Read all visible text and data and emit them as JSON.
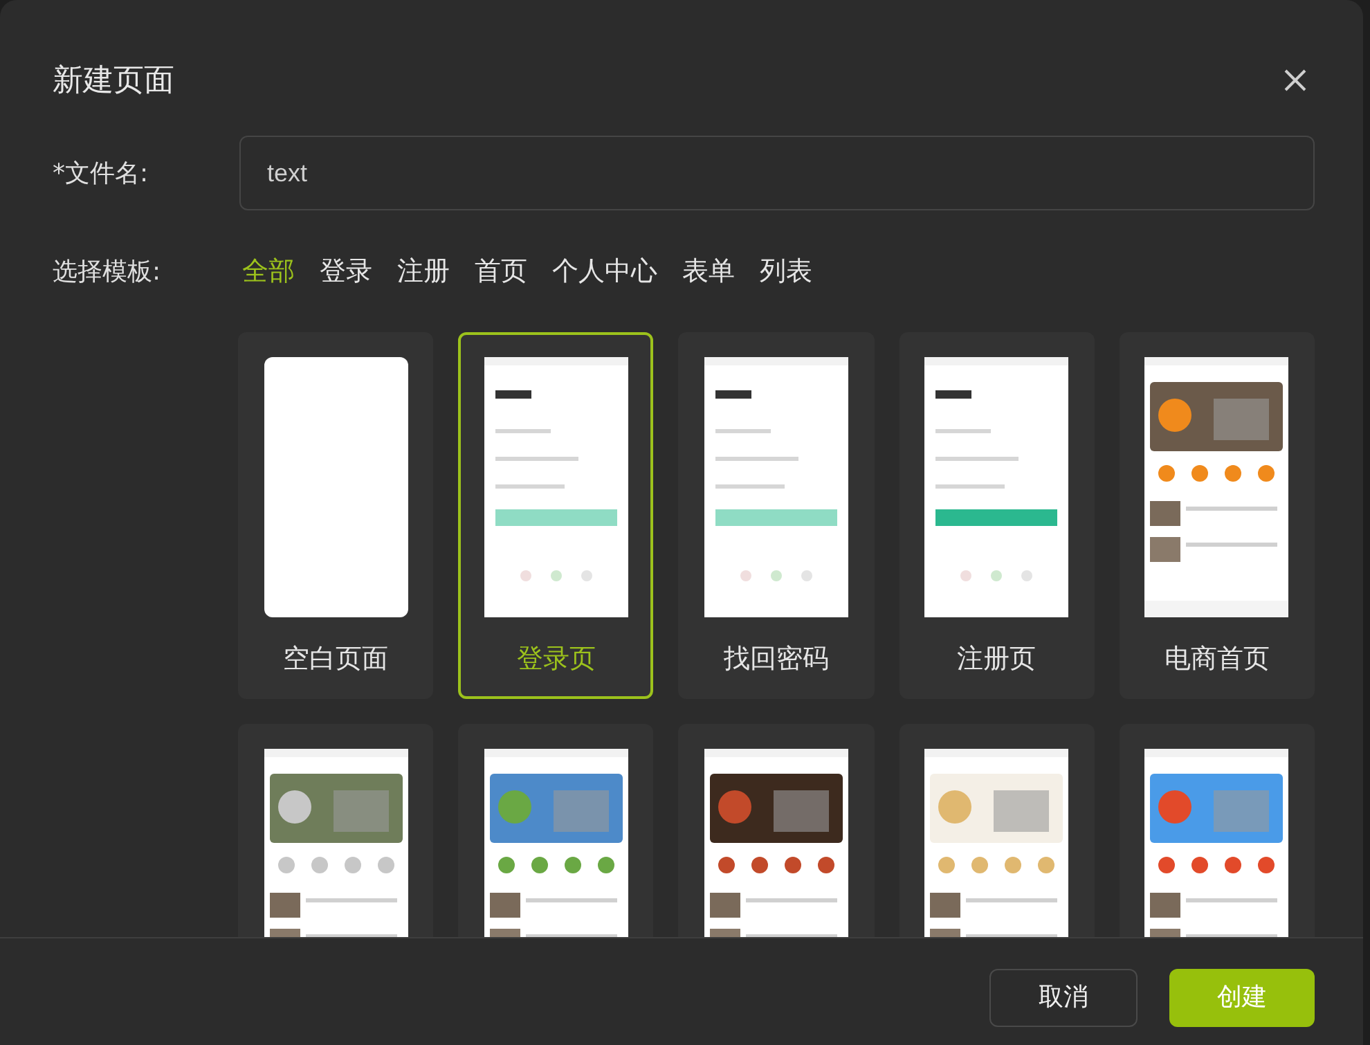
{
  "dialog": {
    "title": "新建页面"
  },
  "file_name": {
    "label": "*文件名:",
    "value": "text"
  },
  "template_filter": {
    "label": "选择模板:",
    "tabs": [
      {
        "label": "全部",
        "selected": true
      },
      {
        "label": "登录",
        "selected": false
      },
      {
        "label": "注册",
        "selected": false
      },
      {
        "label": "首页",
        "selected": false
      },
      {
        "label": "个人中心",
        "selected": false
      },
      {
        "label": "表单",
        "selected": false
      },
      {
        "label": "列表",
        "selected": false
      }
    ]
  },
  "templates": [
    {
      "label": "空白页面",
      "kind": "blank",
      "selected": false
    },
    {
      "label": "登录页",
      "kind": "picture",
      "selected": true
    },
    {
      "label": "找回密码",
      "kind": "picture",
      "selected": false
    },
    {
      "label": "注册页",
      "kind": "picture",
      "selected": false
    },
    {
      "label": "电商首页",
      "kind": "picture",
      "selected": false
    },
    {
      "kind": "picture",
      "selected": false
    },
    {
      "kind": "picture",
      "selected": false
    },
    {
      "kind": "picture",
      "selected": false
    },
    {
      "kind": "picture",
      "selected": false
    },
    {
      "kind": "picture",
      "selected": false
    }
  ],
  "buttons": [
    {
      "label": "取消",
      "kind": "secondary"
    },
    {
      "label": "创建",
      "kind": "primary"
    }
  ]
}
